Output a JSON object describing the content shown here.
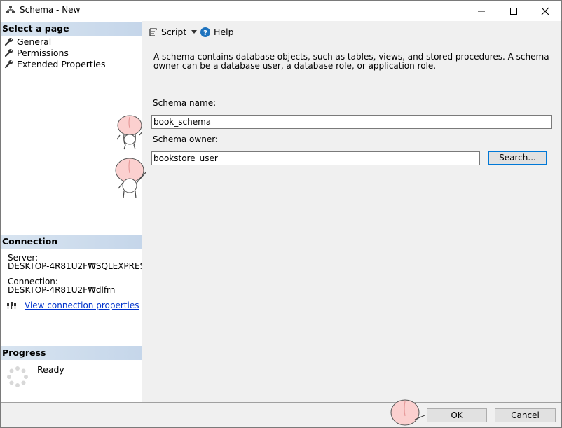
{
  "window": {
    "title": "Schema - New"
  },
  "left": {
    "select_page_title": "Select a page",
    "pages": [
      {
        "label": "General",
        "icon": "wrench-icon"
      },
      {
        "label": "Permissions",
        "icon": "wrench-icon"
      },
      {
        "label": "Extended Properties",
        "icon": "wrench-icon"
      }
    ],
    "connection": {
      "title": "Connection",
      "server_label": "Server:",
      "server_value": "DESKTOP-4R81U2F₩SQLEXPRES",
      "connection_label": "Connection:",
      "connection_value": "DESKTOP-4R81U2F₩dlfrn",
      "view_link": "View connection properties"
    },
    "progress": {
      "title": "Progress",
      "status": "Ready"
    }
  },
  "toolbar": {
    "script_label": "Script",
    "help_label": "Help"
  },
  "main": {
    "description": "A schema contains database objects, such as tables, views, and stored procedures. A schema owner can be a database user, a database role, or application role.",
    "schema_name_label": "Schema name:",
    "schema_name_value": "book_schema",
    "schema_owner_label": "Schema owner:",
    "schema_owner_value": "bookstore_user",
    "search_button": "Search..."
  },
  "footer": {
    "ok_label": "OK",
    "cancel_label": "Cancel"
  },
  "colors": {
    "section_header": "#c5d6ea",
    "link": "#0033cc",
    "focus_border": "#0078d7",
    "help_icon": "#1e73be"
  }
}
